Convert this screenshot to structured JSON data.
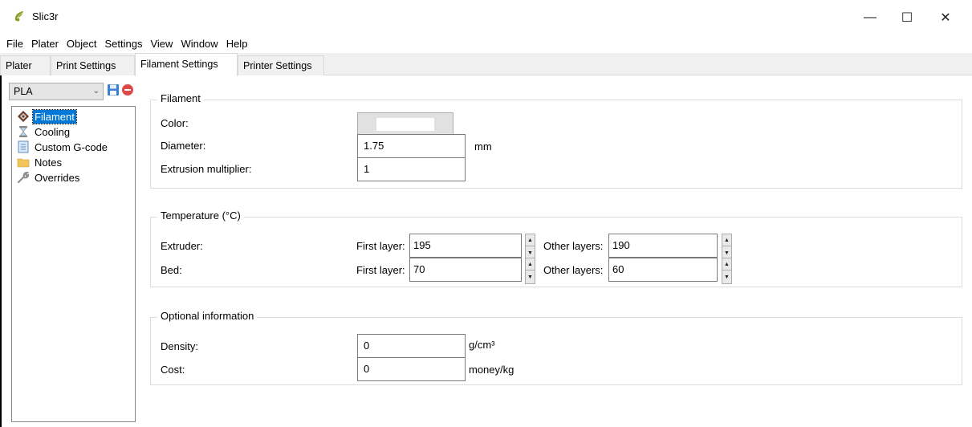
{
  "window": {
    "title": "Slic3r",
    "minimize_symbol": "—",
    "maximize_symbol": "☐",
    "close_symbol": "✕"
  },
  "menu": [
    "File",
    "Plater",
    "Object",
    "Settings",
    "View",
    "Window",
    "Help"
  ],
  "tabs": [
    {
      "label": "Plater",
      "active": false
    },
    {
      "label": "Print Settings",
      "active": false
    },
    {
      "label": "Filament Settings",
      "active": true
    },
    {
      "label": "Printer Settings",
      "active": false
    }
  ],
  "sidebar": {
    "preset": "PLA",
    "items": [
      {
        "label": "Filament",
        "icon": "spool-icon",
        "selected": true
      },
      {
        "label": "Cooling",
        "icon": "hourglass-icon",
        "selected": false
      },
      {
        "label": "Custom G-code",
        "icon": "document-icon",
        "selected": false
      },
      {
        "label": "Notes",
        "icon": "folder-icon",
        "selected": false
      },
      {
        "label": "Overrides",
        "icon": "wrench-icon",
        "selected": false
      }
    ]
  },
  "filament": {
    "title": "Filament",
    "color_label": "Color:",
    "color_value": "#ffffff",
    "diameter_label": "Diameter:",
    "diameter_value": "1.75",
    "diameter_unit": "mm",
    "multiplier_label": "Extrusion multiplier:",
    "multiplier_value": "1"
  },
  "temperature": {
    "title": "Temperature (°C)",
    "first_layer_label": "First layer:",
    "other_layers_label": "Other layers:",
    "extruder_label": "Extruder:",
    "extruder_first": "195",
    "extruder_other": "190",
    "bed_label": "Bed:",
    "bed_first": "70",
    "bed_other": "60"
  },
  "optional": {
    "title": "Optional information",
    "density_label": "Density:",
    "density_value": "0",
    "density_unit": "g/cm³",
    "cost_label": "Cost:",
    "cost_value": "0",
    "cost_unit": "money/kg"
  }
}
